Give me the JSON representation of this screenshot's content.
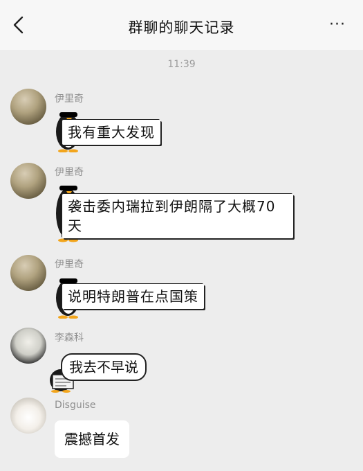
{
  "header": {
    "title": "群聊的聊天记录",
    "more_label": "···"
  },
  "time_divider": "11:39",
  "messages": [
    {
      "sender": "伊里奇",
      "text": "我有重大发现",
      "avatar": "military-portrait-avatar"
    },
    {
      "sender": "伊里奇",
      "text_line1": "袭击委内瑞拉到伊朗隔了大概70",
      "text_line2": "天",
      "avatar": "military-portrait-avatar"
    },
    {
      "sender": "伊里奇",
      "text": "说明特朗普在点国策",
      "avatar": "military-portrait-avatar"
    },
    {
      "sender": "李森科",
      "text": "我去不早说",
      "avatar": "suited-man-avatar"
    },
    {
      "sender": "Disguise",
      "text": "震撼首发",
      "avatar": "white-puppy-avatar"
    }
  ]
}
